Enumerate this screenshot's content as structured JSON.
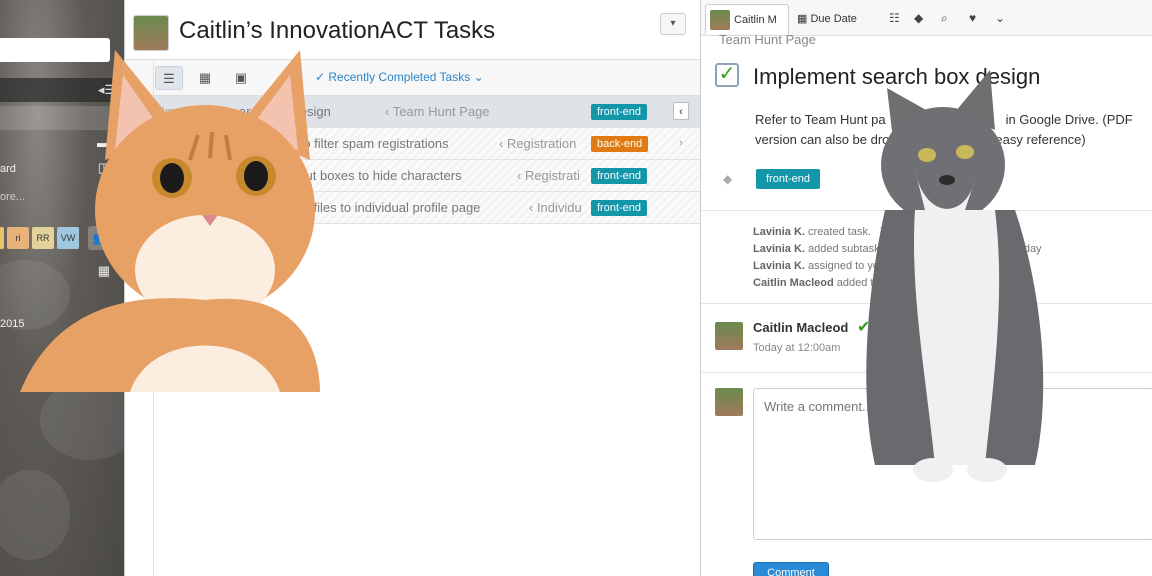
{
  "sidebar": {
    "collapse_icon": "collapse-left-icon",
    "items": [
      {
        "label": "ard",
        "icon": "chart-icon"
      },
      {
        "label": "ore..."
      },
      {
        "label": "2015"
      }
    ],
    "team_avatars": [
      {
        "label": "ri",
        "color": "#e9b27a"
      },
      {
        "label": "RR",
        "color": "#e3d39b"
      },
      {
        "label": "VW",
        "color": "#9fc7e0"
      }
    ],
    "people_icon": "people-icon"
  },
  "list": {
    "title": "Caitlin’s InnovationACT Tasks",
    "collapse_label": "⌄",
    "toolbar": {
      "completed_link": "Recently Completed Tasks"
    },
    "tasks": [
      {
        "name": "Implement search box design",
        "visible_name": "...arch box design",
        "project": "‹ Team Hunt Page",
        "tag": "front-end",
        "tag_type": "front",
        "selected": true
      },
      {
        "name": "way to filter spam registrations",
        "visible_name": "...way to filter spam registrations",
        "project": "‹ Registration",
        "tag": "back-end",
        "tag_type": "back",
        "selected": false
      },
      {
        "name": "rd input boxes to hide characters",
        "visible_name": "...rd input boxes to hide characters",
        "project": "‹ Registrati",
        "tag": "front-end",
        "tag_type": "front",
        "selected": false
      },
      {
        "name": "ant profiles to individual profile page",
        "visible_name": "...ant profiles to individual profile page",
        "project": "‹ Individu",
        "tag": "front-end",
        "tag_type": "front",
        "selected": false
      }
    ]
  },
  "detail": {
    "assignee": "Caitlin M",
    "due_date_label": "Due Date",
    "project": "Team Hunt Page",
    "title": "Implement search box design",
    "description_line1": "Refer to Team Hunt pa",
    "description_line1b": "in Google Drive. (PDF",
    "description_line2": "version can also be dro",
    "description_line2b": "easy reference)",
    "tag": "front-end",
    "activity": [
      {
        "who": "Lavinia K.",
        "what": "created task.",
        "extra": "T"
      },
      {
        "who": "Lavinia K.",
        "what": "added subtask t",
        "extra": "Thursday"
      },
      {
        "who": "Lavinia K.",
        "what": "assigned to you",
        "extra": ""
      },
      {
        "who": "Caitlin Macleod",
        "what": "added to",
        "extra": ""
      }
    ],
    "comment": {
      "author": "Caitlin Macleod",
      "time": "Today at 12:00am"
    },
    "comment_placeholder": "Write a comment...",
    "comment_button": "Comment"
  }
}
